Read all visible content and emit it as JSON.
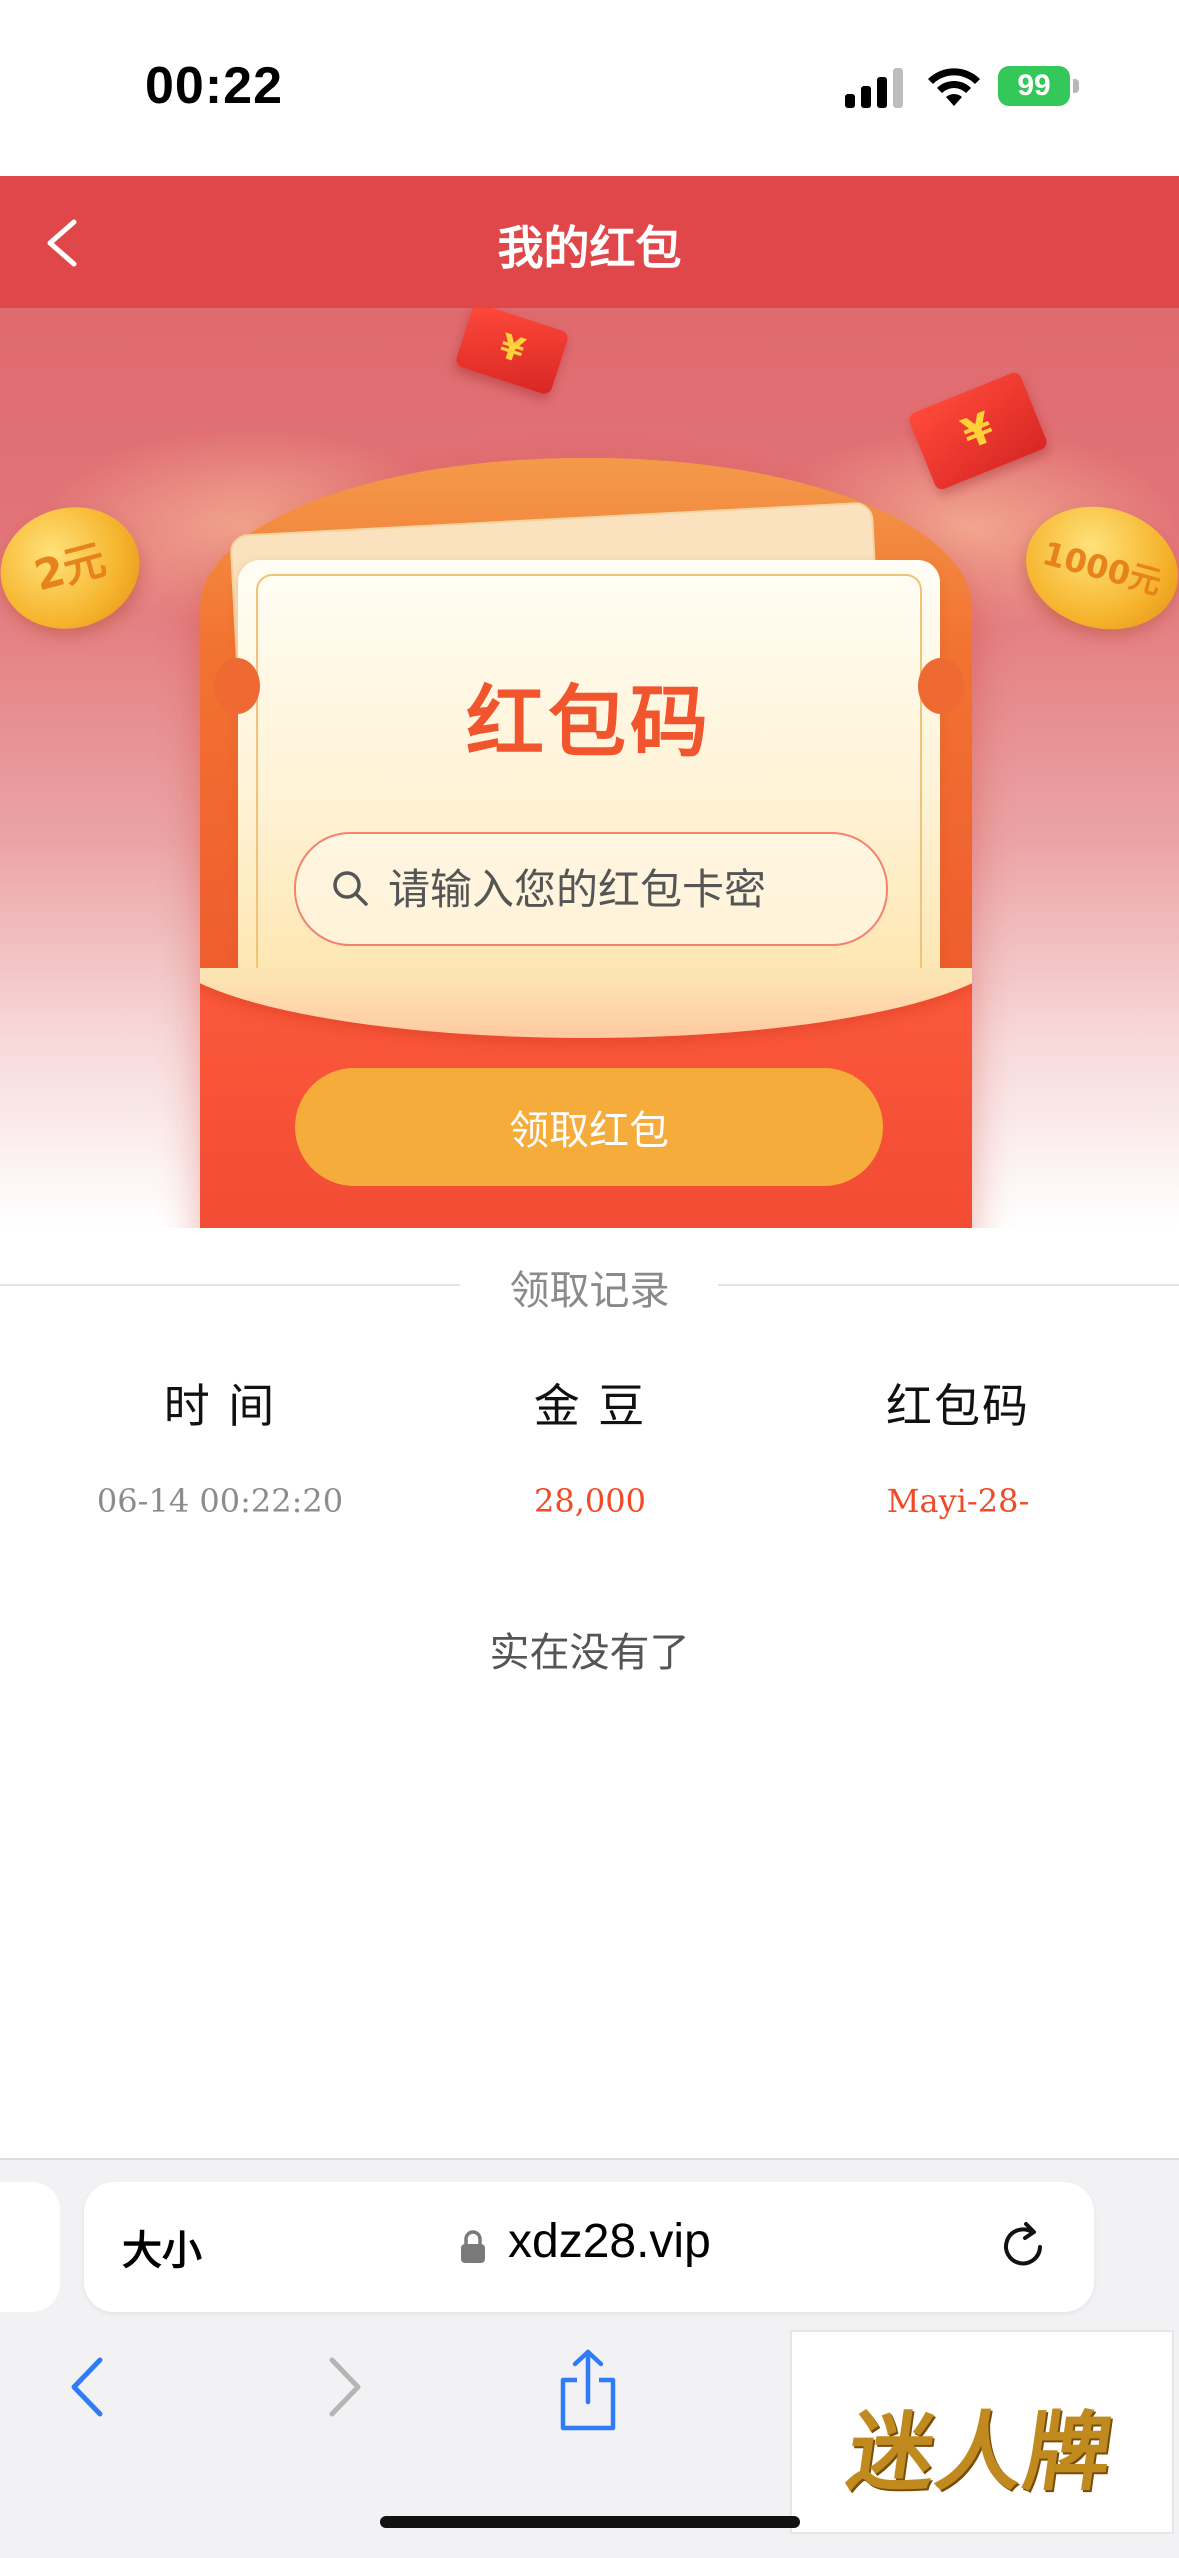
{
  "status_bar": {
    "time": "00:22",
    "battery": "99"
  },
  "header": {
    "title": "我的红包"
  },
  "hero": {
    "coin_left": "2元",
    "coin_right": "1000元",
    "envelope_symbol": "¥",
    "card_title": "红包码",
    "search_placeholder": "请输入您的红包卡密",
    "claim_button": "领取红包"
  },
  "records": {
    "section_title": "领取记录",
    "columns": [
      "时 间",
      "金 豆",
      "红包码"
    ],
    "rows": [
      {
        "time": "06-14 00:22:20",
        "beans": "28,000",
        "code": "Mayi-28-"
      }
    ],
    "empty_note": "实在没有了"
  },
  "browser": {
    "aa_label": "大小",
    "url": "xdz28.vip",
    "watermark": "迷人牌"
  },
  "colors": {
    "header_bg": "#e0474a",
    "accent_red": "#f04a26",
    "button_orange": "#f6ac3b"
  }
}
